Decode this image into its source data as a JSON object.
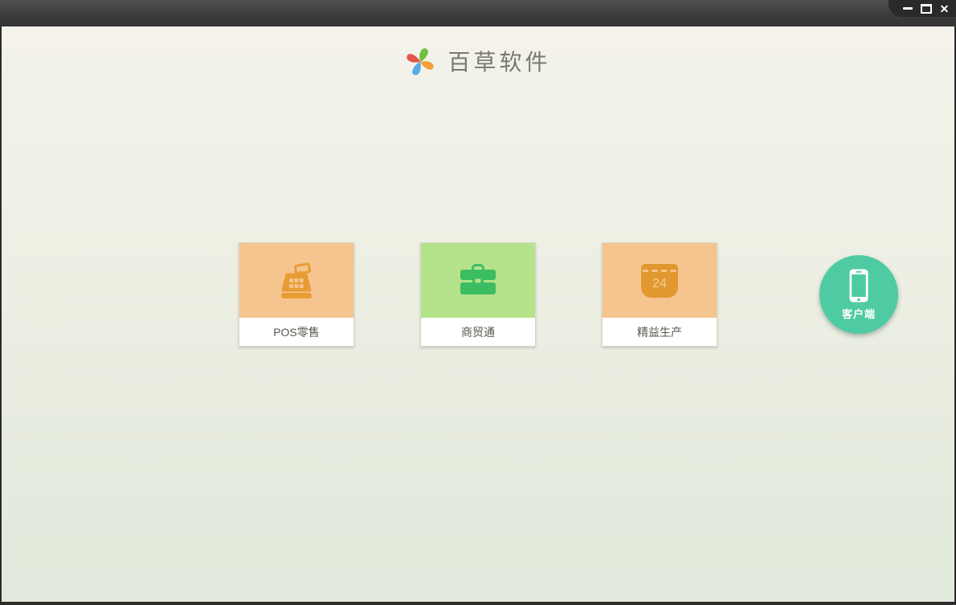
{
  "window": {
    "controls": {
      "minimize_icon": "minimize",
      "maximize_icon": "maximize",
      "close_icon": "close",
      "close_glyph": "✕"
    }
  },
  "header": {
    "app_title": "百草软件",
    "logo": {
      "icon": "pinwheel-logo-icon",
      "petal_colors": {
        "top": "#72bf44",
        "right": "#f5a23c",
        "bottom": "#5aace2",
        "left": "#e2574c"
      }
    }
  },
  "products": [
    {
      "label": "POS零售",
      "icon": "cash-register-icon",
      "bg_color": "#f6c48e",
      "icon_color": "#e89c35"
    },
    {
      "label": "商贸通",
      "icon": "briefcase-icon",
      "bg_color": "#b5e38b",
      "icon_color": "#3cbd62"
    },
    {
      "label": "精益生产",
      "icon": "calendar-24-icon",
      "bg_color": "#f6c48e",
      "icon_color": "#e0982f",
      "calendar_day": "24"
    }
  ],
  "client_button": {
    "label": "客户端",
    "icon": "smartphone-icon",
    "bg_color": "#4fcba3"
  },
  "theme": {
    "titlebar_gradient_top": "#505050",
    "titlebar_gradient_bottom": "#343434",
    "frame_color": "#2b2b2b",
    "content_gradient_top": "#f4f2eb",
    "content_gradient_bottom": "#e0e9db",
    "card_label_text": "#5a564e",
    "app_title_text": "#78786f",
    "white": "#ffffff"
  }
}
